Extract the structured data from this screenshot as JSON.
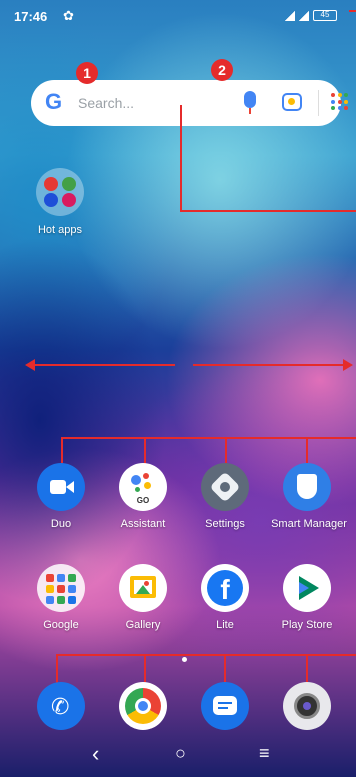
{
  "status": {
    "time": "17:46",
    "battery": "45"
  },
  "search": {
    "placeholder": "Search..."
  },
  "badges": [
    "1",
    "2"
  ],
  "hot_apps": {
    "label": "Hot apps"
  },
  "row1": [
    {
      "label": "Duo"
    },
    {
      "label": "Assistant",
      "sub": "GO"
    },
    {
      "label": "Settings"
    },
    {
      "label": "Smart Manager"
    }
  ],
  "row2": [
    {
      "label": "Google"
    },
    {
      "label": "Gallery"
    },
    {
      "label": "Lite"
    },
    {
      "label": "Play Store"
    }
  ],
  "dock": [
    {
      "name": "phone"
    },
    {
      "name": "chrome"
    },
    {
      "name": "messages"
    },
    {
      "name": "camera"
    }
  ],
  "nav": {
    "back": "‹",
    "home": "○",
    "recents": "≡"
  }
}
